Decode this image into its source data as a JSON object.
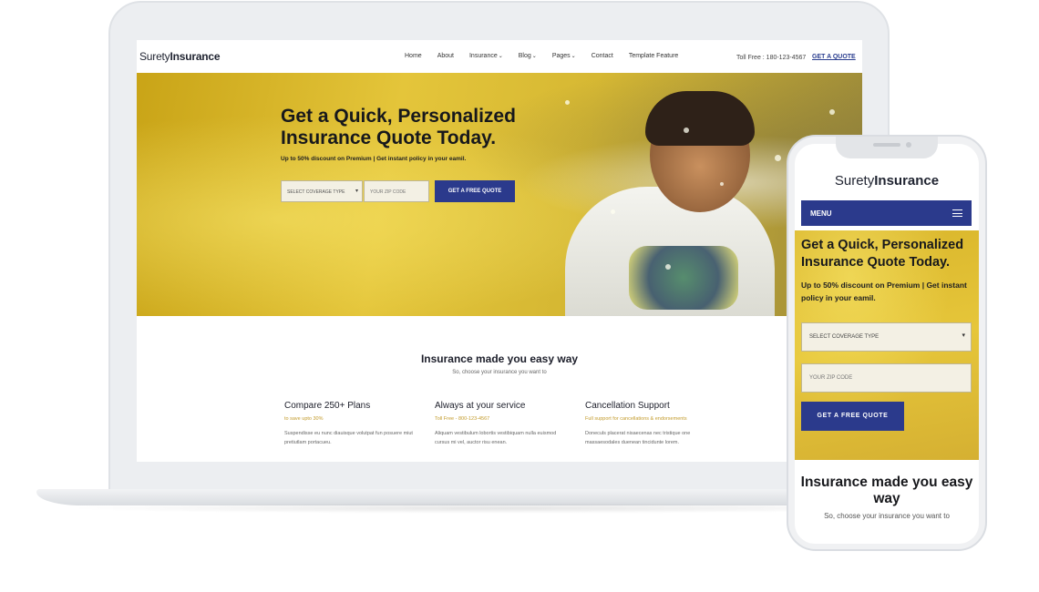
{
  "brand": {
    "logo_prefix": "Surety",
    "logo_bold": "Insurance"
  },
  "desktop": {
    "nav": {
      "home": "Home",
      "about": "About",
      "insurance": "Insurance",
      "blog": "Blog",
      "pages": "Pages",
      "contact": "Contact",
      "template_feature": "Template Feature",
      "caret": "⌄"
    },
    "toll_free": "Toll Free : 180-123-4567",
    "get_quote_link": "GET A QUOTE",
    "hero": {
      "title": "Get a Quick, Personalized Insurance Quote Today.",
      "subtitle": "Up to 50% discount on Premium | Get instant policy in your eamil.",
      "select_placeholder": "SELECT COVERAGE TYPE",
      "zip_placeholder": "YOUR ZIP CODE",
      "button": "GET A FREE QUOTE"
    },
    "section": {
      "title": "Insurance made you easy way",
      "subtitle": "So, choose your insurance you want to"
    },
    "features": [
      {
        "title": "Compare 250+ Plans",
        "sub": "to save upto 30%",
        "desc": "Suspendisse eu nunc diauisque volutpat fun posuere miut pretiutlam portacueu."
      },
      {
        "title": "Always at your service",
        "sub": "Toll Free - 800-123-4567",
        "desc": "Aliquam vestibulum lobortis vestibiquam nulla euismod cursus mi vel, auctor risu enean."
      },
      {
        "title": "Cancellation Support",
        "sub": "Full support for cancellations & endorsements",
        "desc": "Doneculs placerat nisaecenas nec tristique one massaesodales duenean tincidunte lorem."
      }
    ]
  },
  "mobile": {
    "menu_label": "MENU",
    "hero": {
      "title": "Get a Quick, Personalized Insurance Quote Today.",
      "subtitle": "Up to 50% discount on Premium | Get instant policy in your eamil.",
      "select_placeholder": "SELECT COVERAGE TYPE",
      "zip_placeholder": "YOUR ZIP CODE",
      "button": "GET A FREE QUOTE"
    },
    "section": {
      "title": "Insurance made you easy way",
      "subtitle": "So, choose your insurance you want to"
    }
  },
  "icons": {
    "dropdown_arrow": "▾",
    "hamburger": "menu-icon"
  },
  "colors": {
    "accent_blue": "#2b3a8c",
    "hero_yellow": "#e0c03a",
    "feature_sub_gold": "#c29a2a"
  }
}
